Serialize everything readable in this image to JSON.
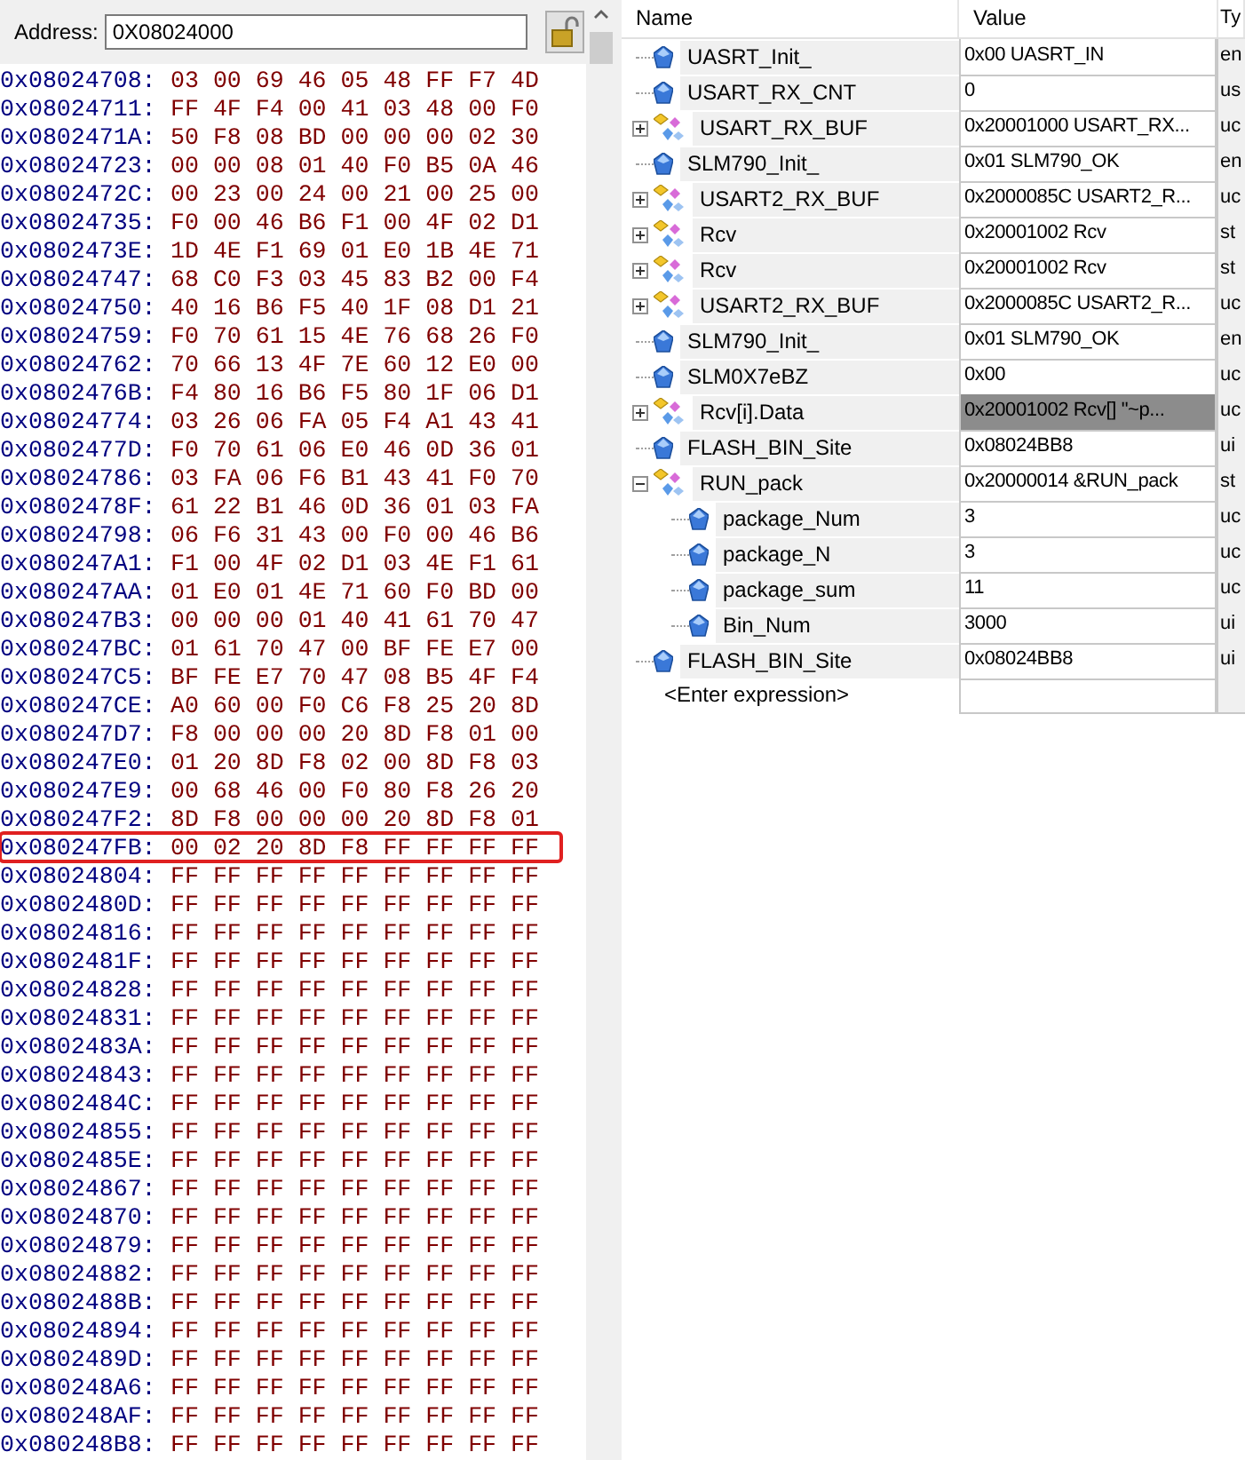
{
  "memory": {
    "address_label": "Address:",
    "address_value": "0X08024000",
    "rows": [
      {
        "address": "0x08024708:",
        "bytes": "03 00 69 46 05 48 FF F7 4D",
        "highlighted": false
      },
      {
        "address": "0x08024711:",
        "bytes": "FF 4F F4 00 41 03 48 00 F0",
        "highlighted": false
      },
      {
        "address": "0x0802471A:",
        "bytes": "50 F8 08 BD 00 00 00 02 30",
        "highlighted": false
      },
      {
        "address": "0x08024723:",
        "bytes": "00 00 08 01 40 F0 B5 0A 46",
        "highlighted": false
      },
      {
        "address": "0x0802472C:",
        "bytes": "00 23 00 24 00 21 00 25 00",
        "highlighted": false
      },
      {
        "address": "0x08024735:",
        "bytes": "F0 00 46 B6 F1 00 4F 02 D1",
        "highlighted": false
      },
      {
        "address": "0x0802473E:",
        "bytes": "1D 4E F1 69 01 E0 1B 4E 71",
        "highlighted": false
      },
      {
        "address": "0x08024747:",
        "bytes": "68 C0 F3 03 45 83 B2 00 F4",
        "highlighted": false
      },
      {
        "address": "0x08024750:",
        "bytes": "40 16 B6 F5 40 1F 08 D1 21",
        "highlighted": false
      },
      {
        "address": "0x08024759:",
        "bytes": "F0 70 61 15 4E 76 68 26 F0",
        "highlighted": false
      },
      {
        "address": "0x08024762:",
        "bytes": "70 66 13 4F 7E 60 12 E0 00",
        "highlighted": false
      },
      {
        "address": "0x0802476B:",
        "bytes": "F4 80 16 B6 F5 80 1F 06 D1",
        "highlighted": false
      },
      {
        "address": "0x08024774:",
        "bytes": "03 26 06 FA 05 F4 A1 43 41",
        "highlighted": false
      },
      {
        "address": "0x0802477D:",
        "bytes": "F0 70 61 06 E0 46 0D 36 01",
        "highlighted": false
      },
      {
        "address": "0x08024786:",
        "bytes": "03 FA 06 F6 B1 43 41 F0 70",
        "highlighted": false
      },
      {
        "address": "0x0802478F:",
        "bytes": "61 22 B1 46 0D 36 01 03 FA",
        "highlighted": false
      },
      {
        "address": "0x08024798:",
        "bytes": "06 F6 31 43 00 F0 00 46 B6",
        "highlighted": false
      },
      {
        "address": "0x080247A1:",
        "bytes": "F1 00 4F 02 D1 03 4E F1 61",
        "highlighted": false
      },
      {
        "address": "0x080247AA:",
        "bytes": "01 E0 01 4E 71 60 F0 BD 00",
        "highlighted": false
      },
      {
        "address": "0x080247B3:",
        "bytes": "00 00 00 01 40 41 61 70 47",
        "highlighted": false
      },
      {
        "address": "0x080247BC:",
        "bytes": "01 61 70 47 00 BF FE E7 00",
        "highlighted": false
      },
      {
        "address": "0x080247C5:",
        "bytes": "BF FE E7 70 47 08 B5 4F F4",
        "highlighted": false
      },
      {
        "address": "0x080247CE:",
        "bytes": "A0 60 00 F0 C6 F8 25 20 8D",
        "highlighted": false
      },
      {
        "address": "0x080247D7:",
        "bytes": "F8 00 00 00 20 8D F8 01 00",
        "highlighted": false
      },
      {
        "address": "0x080247E0:",
        "bytes": "01 20 8D F8 02 00 8D F8 03",
        "highlighted": false
      },
      {
        "address": "0x080247E9:",
        "bytes": "00 68 46 00 F0 80 F8 26 20",
        "highlighted": false
      },
      {
        "address": "0x080247F2:",
        "bytes": "8D F8 00 00 00 20 8D F8 01",
        "highlighted": false
      },
      {
        "address": "0x080247FB:",
        "bytes": "00 02 20 8D F8 FF FF FF FF",
        "highlighted": true
      },
      {
        "address": "0x08024804:",
        "bytes": "FF FF FF FF FF FF FF FF FF",
        "highlighted": false
      },
      {
        "address": "0x0802480D:",
        "bytes": "FF FF FF FF FF FF FF FF FF",
        "highlighted": false
      },
      {
        "address": "0x08024816:",
        "bytes": "FF FF FF FF FF FF FF FF FF",
        "highlighted": false
      },
      {
        "address": "0x0802481F:",
        "bytes": "FF FF FF FF FF FF FF FF FF",
        "highlighted": false
      },
      {
        "address": "0x08024828:",
        "bytes": "FF FF FF FF FF FF FF FF FF",
        "highlighted": false
      },
      {
        "address": "0x08024831:",
        "bytes": "FF FF FF FF FF FF FF FF FF",
        "highlighted": false
      },
      {
        "address": "0x0802483A:",
        "bytes": "FF FF FF FF FF FF FF FF FF",
        "highlighted": false
      },
      {
        "address": "0x08024843:",
        "bytes": "FF FF FF FF FF FF FF FF FF",
        "highlighted": false
      },
      {
        "address": "0x0802484C:",
        "bytes": "FF FF FF FF FF FF FF FF FF",
        "highlighted": false
      },
      {
        "address": "0x08024855:",
        "bytes": "FF FF FF FF FF FF FF FF FF",
        "highlighted": false
      },
      {
        "address": "0x0802485E:",
        "bytes": "FF FF FF FF FF FF FF FF FF",
        "highlighted": false
      },
      {
        "address": "0x08024867:",
        "bytes": "FF FF FF FF FF FF FF FF FF",
        "highlighted": false
      },
      {
        "address": "0x08024870:",
        "bytes": "FF FF FF FF FF FF FF FF FF",
        "highlighted": false
      },
      {
        "address": "0x08024879:",
        "bytes": "FF FF FF FF FF FF FF FF FF",
        "highlighted": false
      },
      {
        "address": "0x08024882:",
        "bytes": "FF FF FF FF FF FF FF FF FF",
        "highlighted": false
      },
      {
        "address": "0x0802488B:",
        "bytes": "FF FF FF FF FF FF FF FF FF",
        "highlighted": false
      },
      {
        "address": "0x08024894:",
        "bytes": "FF FF FF FF FF FF FF FF FF",
        "highlighted": false
      },
      {
        "address": "0x0802489D:",
        "bytes": "FF FF FF FF FF FF FF FF FF",
        "highlighted": false
      },
      {
        "address": "0x080248A6:",
        "bytes": "FF FF FF FF FF FF FF FF FF",
        "highlighted": false
      },
      {
        "address": "0x080248AF:",
        "bytes": "FF FF FF FF FF FF FF FF FF",
        "highlighted": false
      },
      {
        "address": "0x080248B8:",
        "bytes": "FF FF FF FF FF FF FF FF FF",
        "highlighted": false
      }
    ]
  },
  "watch": {
    "columns": [
      "Name",
      "Value",
      "Ty"
    ],
    "items": [
      {
        "kind": "variable",
        "name": "UASRT_Init_",
        "value": "0x00 UASRT_IN",
        "type": "en",
        "selected": false
      },
      {
        "kind": "variable",
        "name": "USART_RX_CNT",
        "value": "0",
        "type": "us",
        "selected": false
      },
      {
        "kind": "struct",
        "name": "USART_RX_BUF",
        "value": "0x20001000 USART_RX...",
        "type": "uc",
        "expanded": false,
        "selected": false
      },
      {
        "kind": "variable",
        "name": "SLM790_Init_",
        "value": "0x01 SLM790_OK",
        "type": "en",
        "selected": false
      },
      {
        "kind": "struct",
        "name": "USART2_RX_BUF",
        "value": "0x2000085C USART2_R...",
        "type": "uc",
        "expanded": false,
        "selected": false
      },
      {
        "kind": "struct",
        "name": "Rcv",
        "value": "0x20001002 Rcv",
        "type": "st",
        "expanded": false,
        "selected": false
      },
      {
        "kind": "struct",
        "name": "Rcv",
        "value": "0x20001002 Rcv",
        "type": "st",
        "expanded": false,
        "selected": false
      },
      {
        "kind": "struct",
        "name": "USART2_RX_BUF",
        "value": "0x2000085C USART2_R...",
        "type": "uc",
        "expanded": false,
        "selected": false
      },
      {
        "kind": "variable",
        "name": "SLM790_Init_",
        "value": "0x01 SLM790_OK",
        "type": "en",
        "selected": false
      },
      {
        "kind": "variable",
        "name": "SLM0X7eBZ",
        "value": "0x00",
        "type": "uc",
        "selected": false
      },
      {
        "kind": "struct",
        "name": "Rcv[i].Data",
        "value": "0x20001002 Rcv[] \"~p...",
        "type": "uc",
        "expanded": false,
        "selected": true
      },
      {
        "kind": "variable",
        "name": "FLASH_BIN_Site",
        "value": "0x08024BB8",
        "type": "ui",
        "selected": false
      },
      {
        "kind": "struct",
        "name": "RUN_pack",
        "value": "0x20000014 &RUN_pack",
        "type": "st",
        "expanded": true,
        "selected": false,
        "children": [
          {
            "kind": "variable",
            "name": "package_Num",
            "value": "3",
            "type": "uc",
            "selected": false
          },
          {
            "kind": "variable",
            "name": "package_N",
            "value": "3",
            "type": "uc",
            "selected": false
          },
          {
            "kind": "variable",
            "name": "package_sum",
            "value": "11",
            "type": "uc",
            "selected": false
          },
          {
            "kind": "variable",
            "name": "Bin_Num",
            "value": "3000",
            "type": "ui",
            "selected": false
          }
        ]
      },
      {
        "kind": "variable",
        "name": "FLASH_BIN_Site",
        "value": "0x08024BB8",
        "type": "ui",
        "selected": false
      }
    ],
    "enter_expression": "<Enter expression>"
  }
}
